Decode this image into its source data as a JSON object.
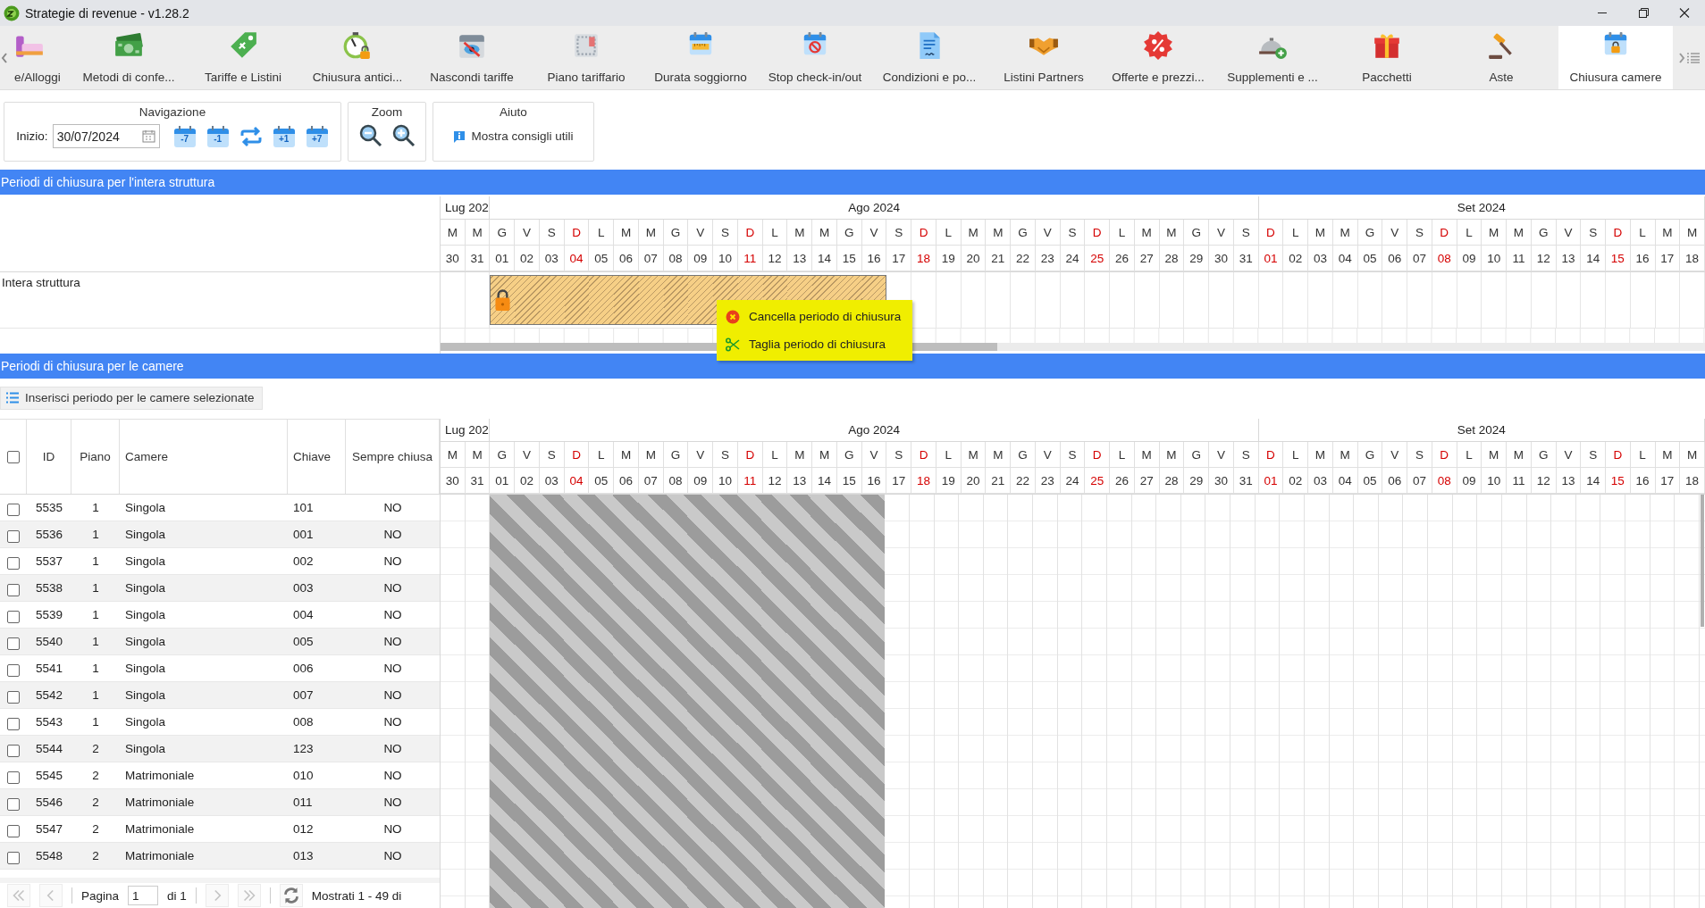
{
  "window": {
    "title": "Strategie di revenue - v1.28.2"
  },
  "toolbar": {
    "items": [
      {
        "label": "e/Alloggi",
        "selected": false
      },
      {
        "label": "Metodi di confe...",
        "selected": false
      },
      {
        "label": "Tariffe e Listini",
        "selected": false
      },
      {
        "label": "Chiusura antici...",
        "selected": false
      },
      {
        "label": "Nascondi tariffe",
        "selected": false
      },
      {
        "label": "Piano tariffario",
        "selected": false
      },
      {
        "label": "Durata soggiorno",
        "selected": false
      },
      {
        "label": "Stop check-in/out",
        "selected": false
      },
      {
        "label": "Condizioni e po...",
        "selected": false
      },
      {
        "label": "Listini Partners",
        "selected": false
      },
      {
        "label": "Offerte e prezzi...",
        "selected": false
      },
      {
        "label": "Supplementi e ...",
        "selected": false
      },
      {
        "label": "Pacchetti",
        "selected": false
      },
      {
        "label": "Aste",
        "selected": false
      },
      {
        "label": "Chiusura camere",
        "selected": true
      }
    ]
  },
  "navigation": {
    "title": "Navigazione",
    "start_label": "Inizio:",
    "start_date": "30/07/2024",
    "buttons": [
      {
        "kind": "step",
        "label": "-7"
      },
      {
        "kind": "step",
        "label": "-1"
      },
      {
        "kind": "swap"
      },
      {
        "kind": "step",
        "label": "+1"
      },
      {
        "kind": "step",
        "label": "+7"
      }
    ]
  },
  "zoom": {
    "title": "Zoom",
    "buttons": [
      {
        "kind": "zoom-out"
      },
      {
        "kind": "zoom-in"
      }
    ]
  },
  "help": {
    "title": "Aiuto",
    "link": "Mostra consigli utili"
  },
  "structure_section": {
    "title": "Periodi di chiusura per l'intera struttura",
    "calendar": {
      "months": [
        {
          "label": "Lug 202",
          "days": [
            {
              "letter": "M",
              "number": "30",
              "sunday": false
            },
            {
              "letter": "M",
              "number": "31",
              "sunday": false
            }
          ]
        },
        {
          "label": "Ago 2024",
          "days": [
            {
              "letter": "G",
              "number": "01",
              "sunday": false
            },
            {
              "letter": "V",
              "number": "02",
              "sunday": false
            },
            {
              "letter": "S",
              "number": "03",
              "sunday": false
            },
            {
              "letter": "D",
              "number": "04",
              "sunday": true
            },
            {
              "letter": "L",
              "number": "05",
              "sunday": false
            },
            {
              "letter": "M",
              "number": "06",
              "sunday": false
            },
            {
              "letter": "M",
              "number": "07",
              "sunday": false
            },
            {
              "letter": "G",
              "number": "08",
              "sunday": false
            },
            {
              "letter": "V",
              "number": "09",
              "sunday": false
            },
            {
              "letter": "S",
              "number": "10",
              "sunday": false
            },
            {
              "letter": "D",
              "number": "11",
              "sunday": true
            },
            {
              "letter": "L",
              "number": "12",
              "sunday": false
            },
            {
              "letter": "M",
              "number": "13",
              "sunday": false
            },
            {
              "letter": "M",
              "number": "14",
              "sunday": false
            },
            {
              "letter": "G",
              "number": "15",
              "sunday": false
            },
            {
              "letter": "V",
              "number": "16",
              "sunday": false
            },
            {
              "letter": "S",
              "number": "17",
              "sunday": false
            },
            {
              "letter": "D",
              "number": "18",
              "sunday": true
            },
            {
              "letter": "L",
              "number": "19",
              "sunday": false
            },
            {
              "letter": "M",
              "number": "20",
              "sunday": false
            },
            {
              "letter": "M",
              "number": "21",
              "sunday": false
            },
            {
              "letter": "G",
              "number": "22",
              "sunday": false
            },
            {
              "letter": "V",
              "number": "23",
              "sunday": false
            },
            {
              "letter": "S",
              "number": "24",
              "sunday": false
            },
            {
              "letter": "D",
              "number": "25",
              "sunday": true
            },
            {
              "letter": "L",
              "number": "26",
              "sunday": false
            },
            {
              "letter": "M",
              "number": "27",
              "sunday": false
            },
            {
              "letter": "M",
              "number": "28",
              "sunday": false
            },
            {
              "letter": "G",
              "number": "29",
              "sunday": false
            },
            {
              "letter": "V",
              "number": "30",
              "sunday": false
            },
            {
              "letter": "S",
              "number": "31",
              "sunday": false
            }
          ]
        },
        {
          "label": "Set 2024",
          "days": [
            {
              "letter": "D",
              "number": "01",
              "sunday": true
            },
            {
              "letter": "L",
              "number": "02",
              "sunday": false
            },
            {
              "letter": "M",
              "number": "03",
              "sunday": false
            },
            {
              "letter": "M",
              "number": "04",
              "sunday": false
            },
            {
              "letter": "G",
              "number": "05",
              "sunday": false
            },
            {
              "letter": "V",
              "number": "06",
              "sunday": false
            },
            {
              "letter": "S",
              "number": "07",
              "sunday": false
            },
            {
              "letter": "D",
              "number": "08",
              "sunday": true
            },
            {
              "letter": "L",
              "number": "09",
              "sunday": false
            },
            {
              "letter": "M",
              "number": "10",
              "sunday": false
            },
            {
              "letter": "M",
              "number": "11",
              "sunday": false
            },
            {
              "letter": "G",
              "number": "12",
              "sunday": false
            },
            {
              "letter": "V",
              "number": "13",
              "sunday": false
            },
            {
              "letter": "S",
              "number": "14",
              "sunday": false
            },
            {
              "letter": "D",
              "number": "15",
              "sunday": true
            },
            {
              "letter": "L",
              "number": "16",
              "sunday": false
            },
            {
              "letter": "M",
              "number": "17",
              "sunday": false
            },
            {
              "letter": "M",
              "number": "18",
              "sunday": false
            }
          ]
        }
      ]
    },
    "rows": [
      {
        "name": "Intera struttura",
        "closed_days": [
          false,
          false,
          true,
          true,
          true,
          true,
          true,
          true,
          true,
          true,
          true,
          true,
          true,
          true,
          true,
          true,
          true,
          true,
          false,
          false,
          false,
          false,
          false,
          false,
          false,
          false,
          false,
          false,
          false,
          false,
          false,
          false,
          false,
          false,
          false,
          false,
          false,
          false,
          false,
          false,
          false,
          false,
          false,
          false,
          false,
          false,
          false,
          false,
          false,
          false,
          false
        ]
      }
    ],
    "context_menu": {
      "items": [
        {
          "kind": "delete",
          "label": "Cancella periodo di chiusura"
        },
        {
          "kind": "cut",
          "label": "Taglia periodo di chiusura"
        }
      ]
    }
  },
  "rooms_section": {
    "title": "Periodi di chiusura per le camere",
    "insert_button": "Inserisci periodo per le camere selezionate",
    "select_all": {
      "checked": false
    },
    "columns": [
      "ID",
      "Piano",
      "Camere",
      "Chiave",
      "Sempre chiusa"
    ],
    "calendar": {
      "months": [
        {
          "label": "Lug 202",
          "days": [
            {
              "letter": "M",
              "number": "30",
              "sunday": false
            },
            {
              "letter": "M",
              "number": "31",
              "sunday": false
            }
          ]
        },
        {
          "label": "Ago 2024",
          "days": [
            {
              "letter": "G",
              "number": "01",
              "sunday": false
            },
            {
              "letter": "V",
              "number": "02",
              "sunday": false
            },
            {
              "letter": "S",
              "number": "03",
              "sunday": false
            },
            {
              "letter": "D",
              "number": "04",
              "sunday": true
            },
            {
              "letter": "L",
              "number": "05",
              "sunday": false
            },
            {
              "letter": "M",
              "number": "06",
              "sunday": false
            },
            {
              "letter": "M",
              "number": "07",
              "sunday": false
            },
            {
              "letter": "G",
              "number": "08",
              "sunday": false
            },
            {
              "letter": "V",
              "number": "09",
              "sunday": false
            },
            {
              "letter": "S",
              "number": "10",
              "sunday": false
            },
            {
              "letter": "D",
              "number": "11",
              "sunday": true
            },
            {
              "letter": "L",
              "number": "12",
              "sunday": false
            },
            {
              "letter": "M",
              "number": "13",
              "sunday": false
            },
            {
              "letter": "M",
              "number": "14",
              "sunday": false
            },
            {
              "letter": "G",
              "number": "15",
              "sunday": false
            },
            {
              "letter": "V",
              "number": "16",
              "sunday": false
            },
            {
              "letter": "S",
              "number": "17",
              "sunday": false
            },
            {
              "letter": "D",
              "number": "18",
              "sunday": true
            },
            {
              "letter": "L",
              "number": "19",
              "sunday": false
            },
            {
              "letter": "M",
              "number": "20",
              "sunday": false
            },
            {
              "letter": "M",
              "number": "21",
              "sunday": false
            },
            {
              "letter": "G",
              "number": "22",
              "sunday": false
            },
            {
              "letter": "V",
              "number": "23",
              "sunday": false
            },
            {
              "letter": "S",
              "number": "24",
              "sunday": false
            },
            {
              "letter": "D",
              "number": "25",
              "sunday": true
            },
            {
              "letter": "L",
              "number": "26",
              "sunday": false
            },
            {
              "letter": "M",
              "number": "27",
              "sunday": false
            },
            {
              "letter": "M",
              "number": "28",
              "sunday": false
            },
            {
              "letter": "G",
              "number": "29",
              "sunday": false
            },
            {
              "letter": "V",
              "number": "30",
              "sunday": false
            },
            {
              "letter": "S",
              "number": "31",
              "sunday": false
            }
          ]
        },
        {
          "label": "Set 2024",
          "days": [
            {
              "letter": "D",
              "number": "01",
              "sunday": true
            },
            {
              "letter": "L",
              "number": "02",
              "sunday": false
            },
            {
              "letter": "M",
              "number": "03",
              "sunday": false
            },
            {
              "letter": "M",
              "number": "04",
              "sunday": false
            },
            {
              "letter": "G",
              "number": "05",
              "sunday": false
            },
            {
              "letter": "V",
              "number": "06",
              "sunday": false
            },
            {
              "letter": "S",
              "number": "07",
              "sunday": false
            },
            {
              "letter": "D",
              "number": "08",
              "sunday": true
            },
            {
              "letter": "L",
              "number": "09",
              "sunday": false
            },
            {
              "letter": "M",
              "number": "10",
              "sunday": false
            },
            {
              "letter": "M",
              "number": "11",
              "sunday": false
            },
            {
              "letter": "G",
              "number": "12",
              "sunday": false
            },
            {
              "letter": "V",
              "number": "13",
              "sunday": false
            },
            {
              "letter": "S",
              "number": "14",
              "sunday": false
            },
            {
              "letter": "D",
              "number": "15",
              "sunday": true
            },
            {
              "letter": "L",
              "number": "16",
              "sunday": false
            },
            {
              "letter": "M",
              "number": "17",
              "sunday": false
            },
            {
              "letter": "M",
              "number": "18",
              "sunday": false
            }
          ]
        }
      ]
    },
    "rows": [
      {
        "checked": false,
        "id": "5535",
        "floor": "1",
        "room": "Singola",
        "key": "101",
        "always_closed": "NO"
      },
      {
        "checked": false,
        "id": "5536",
        "floor": "1",
        "room": "Singola",
        "key": "001",
        "always_closed": "NO"
      },
      {
        "checked": false,
        "id": "5537",
        "floor": "1",
        "room": "Singola",
        "key": "002",
        "always_closed": "NO"
      },
      {
        "checked": false,
        "id": "5538",
        "floor": "1",
        "room": "Singola",
        "key": "003",
        "always_closed": "NO"
      },
      {
        "checked": false,
        "id": "5539",
        "floor": "1",
        "room": "Singola",
        "key": "004",
        "always_closed": "NO"
      },
      {
        "checked": false,
        "id": "5540",
        "floor": "1",
        "room": "Singola",
        "key": "005",
        "always_closed": "NO"
      },
      {
        "checked": false,
        "id": "5541",
        "floor": "1",
        "room": "Singola",
        "key": "006",
        "always_closed": "NO"
      },
      {
        "checked": false,
        "id": "5542",
        "floor": "1",
        "room": "Singola",
        "key": "007",
        "always_closed": "NO"
      },
      {
        "checked": false,
        "id": "5543",
        "floor": "1",
        "room": "Singola",
        "key": "008",
        "always_closed": "NO"
      },
      {
        "checked": false,
        "id": "5544",
        "floor": "2",
        "room": "Singola",
        "key": "123",
        "always_closed": "NO"
      },
      {
        "checked": false,
        "id": "5545",
        "floor": "2",
        "room": "Matrimoniale",
        "key": "010",
        "always_closed": "NO"
      },
      {
        "checked": false,
        "id": "5546",
        "floor": "2",
        "room": "Matrimoniale",
        "key": "011",
        "always_closed": "NO"
      },
      {
        "checked": false,
        "id": "5547",
        "floor": "2",
        "room": "Matrimoniale",
        "key": "012",
        "always_closed": "NO"
      },
      {
        "checked": false,
        "id": "5548",
        "floor": "2",
        "room": "Matrimoniale",
        "key": "013",
        "always_closed": "NO"
      }
    ],
    "closed_days": [
      false,
      false,
      true,
      true,
      true,
      true,
      true,
      true,
      true,
      true,
      true,
      true,
      true,
      true,
      true,
      true,
      true,
      true,
      false,
      false,
      false,
      false,
      false,
      false,
      false,
      false,
      false,
      false,
      false,
      false,
      false,
      false,
      false,
      false,
      false,
      false,
      false,
      false,
      false,
      false,
      false,
      false,
      false,
      false,
      false,
      false,
      false,
      false,
      false,
      false,
      false
    ],
    "pager": {
      "buttons": [
        {
          "kind": "first",
          "disabled": true
        },
        {
          "kind": "prev",
          "disabled": true
        },
        {
          "kind": "next",
          "disabled": true
        },
        {
          "kind": "last",
          "disabled": true
        },
        {
          "kind": "refresh",
          "disabled": false
        }
      ],
      "page_label": "Pagina",
      "page": "1",
      "page_count": "di 1",
      "summary": "Mostrati 1 - 49 di"
    }
  }
}
